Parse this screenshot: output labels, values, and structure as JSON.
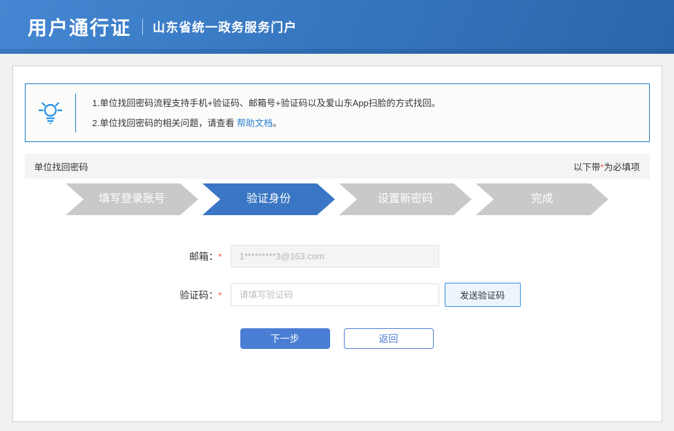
{
  "header": {
    "title": "用户通行证",
    "subtitle": "山东省统一政务服务门户"
  },
  "tip": {
    "line1": "1.单位找回密码流程支持手机+验证码、邮箱号+验证码以及爱山东App扫脸的方式找回。",
    "line2_prefix": "2.单位找回密码的相关问题，请查看 ",
    "line2_link": "帮助文档",
    "line2_suffix": "。"
  },
  "section": {
    "title": "单位找回密码",
    "required_prefix": "以下带",
    "required_star": "*",
    "required_suffix": "为必填项"
  },
  "steps": [
    {
      "label": "填写登录账号",
      "state": "done"
    },
    {
      "label": "验证身份",
      "state": "active"
    },
    {
      "label": "设置新密码",
      "state": "pending"
    },
    {
      "label": "完成",
      "state": "pending"
    }
  ],
  "form": {
    "email": {
      "label": "邮箱：",
      "required_mark": "*",
      "value": "1*********3@163.com"
    },
    "captcha": {
      "label": "验证码：",
      "required_mark": "*",
      "placeholder": "请填写验证码",
      "send_button": "发送验证码"
    },
    "next_button": "下一步",
    "back_button": "返回"
  },
  "colors": {
    "header_blue": "#3474be",
    "active_step_blue": "#3a76c4",
    "button_blue": "#4a7dd4",
    "tip_border_blue": "#1778c8",
    "required_red": "#f25d5d",
    "step_gray": "#c9c9c9"
  }
}
